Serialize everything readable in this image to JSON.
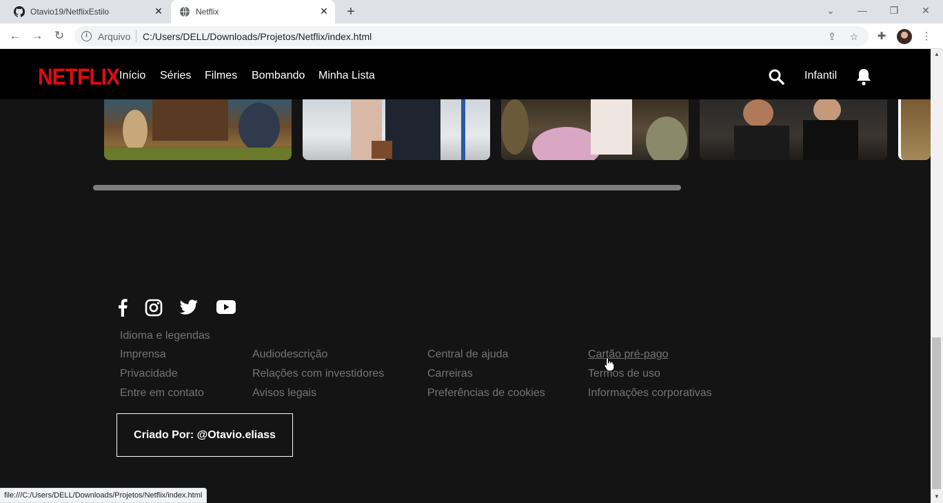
{
  "browser": {
    "tabs": [
      {
        "title": "Otavio19/NetflixEstilo",
        "icon": "github-icon",
        "active": false
      },
      {
        "title": "Netflix",
        "icon": "globe-icon",
        "active": true
      }
    ],
    "address": {
      "protocol_label": "Arquivo",
      "url": "C:/Users/DELL/Downloads/Projetos/Netflix/index.html"
    },
    "status_url": "file:///C:/Users/DELL/Downloads/Projetos/Netflix/index.html"
  },
  "netflix_nav": {
    "logo": "NETFLIX",
    "links": [
      "Início",
      "Séries",
      "Filmes",
      "Bombando",
      "Minha Lista"
    ],
    "kids_label": "Infantil",
    "logo_color": "#e50914"
  },
  "footer": {
    "socials": [
      "facebook-icon",
      "instagram-icon",
      "twitter-icon",
      "youtube-icon"
    ],
    "columns": [
      [
        "Idioma e legendas",
        "Imprensa",
        "Privacidade",
        "Entre em contato"
      ],
      [
        "Audiodescrição",
        "Relações com investidores",
        "Avisos legais"
      ],
      [
        "Central de ajuda",
        "Carreiras",
        "Preferências de cookies"
      ],
      [
        "Cartão pré-pago",
        "Termos de uso",
        "Informações corporativas"
      ]
    ],
    "credit": "Criado Por: @Otavio.eliass"
  }
}
